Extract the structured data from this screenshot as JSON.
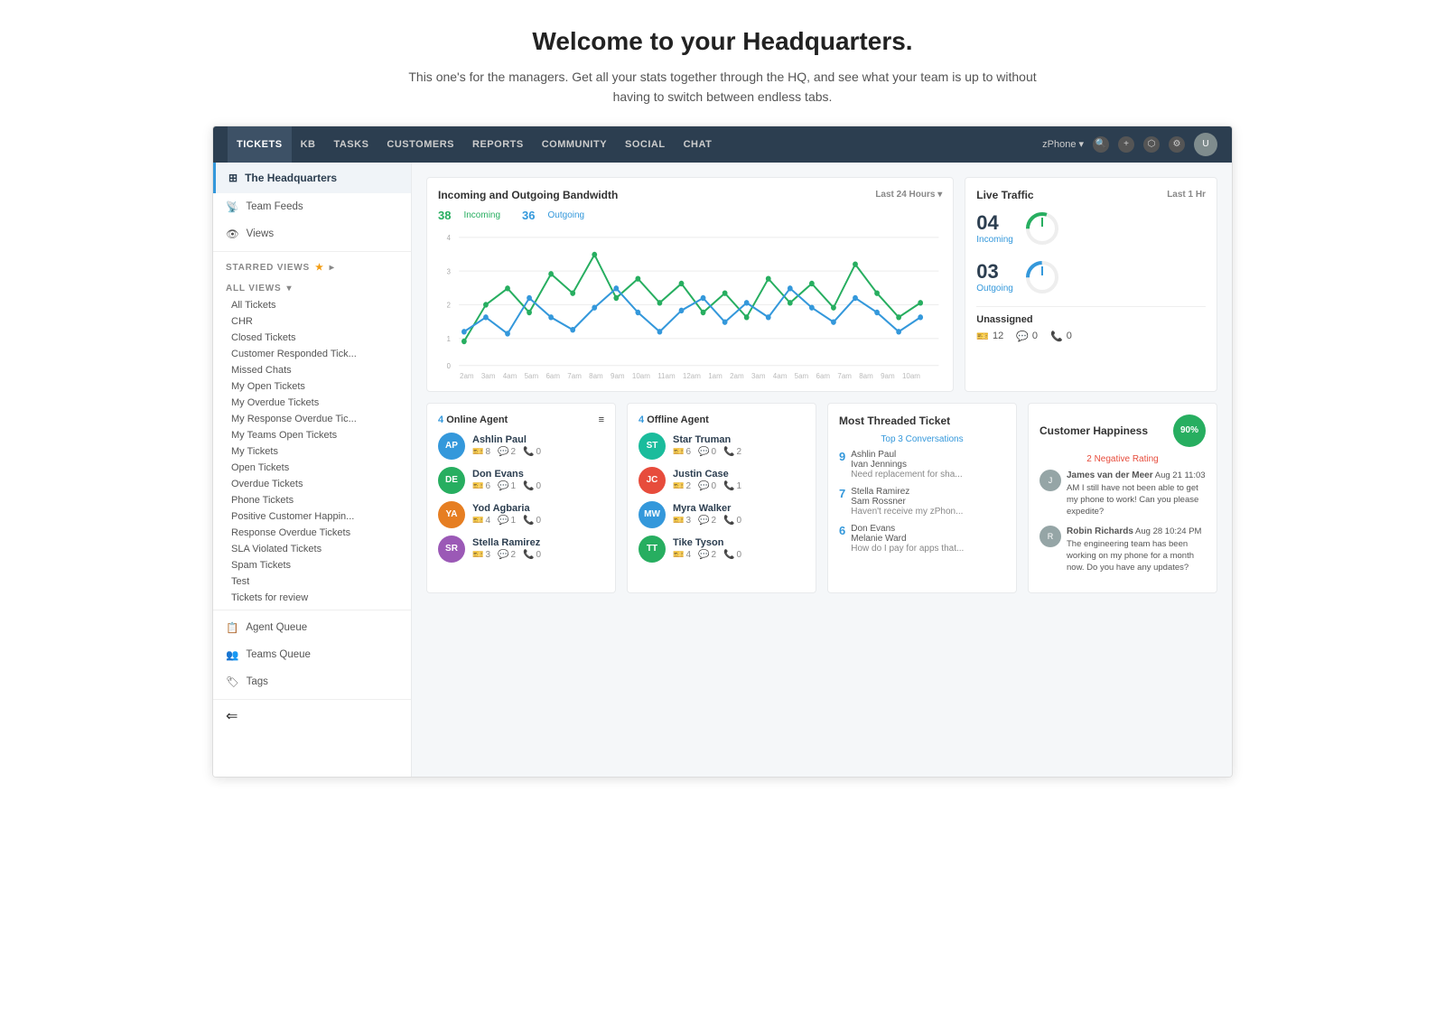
{
  "page": {
    "title": "Welcome to your Headquarters.",
    "subtitle": "This one's for the managers. Get all your stats together through the HQ, and see what your team is up to without having to switch between endless tabs."
  },
  "topnav": {
    "items": [
      "TICKETS",
      "KB",
      "TASKS",
      "CUSTOMERS",
      "REPORTS",
      "COMMUNITY",
      "SOCIAL",
      "CHAT"
    ],
    "active": "TICKETS",
    "brand": "zPhone",
    "icons": [
      "🔍",
      "+",
      "⬡",
      "⚙"
    ]
  },
  "sidebar": {
    "header": "The Headquarters",
    "items": [
      {
        "label": "Team Feeds",
        "icon": "📡"
      },
      {
        "label": "Views",
        "icon": "👁"
      }
    ],
    "starred_label": "STARRED VIEWS",
    "all_label": "ALL VIEWS",
    "links": [
      "All Tickets",
      "CHR",
      "Closed Tickets",
      "Customer Responded Tick...",
      "Missed Chats",
      "My Open Tickets",
      "My Overdue Tickets",
      "My Response Overdue Tic...",
      "My Teams Open Tickets",
      "My Tickets",
      "Open Tickets",
      "Overdue Tickets",
      "Phone Tickets",
      "Positive Customer Happin...",
      "Response Overdue Tickets",
      "SLA Violated Tickets",
      "Spam Tickets",
      "Test",
      "Tickets for review"
    ],
    "agent_queue": "Agent Queue",
    "teams_queue": "Teams Queue",
    "tags": "Tags",
    "collapse_icon": "⇐"
  },
  "bandwidth_chart": {
    "title": "Incoming and Outgoing Bandwidth",
    "time_range": "Last 24 Hours ▾",
    "incoming_count": "38",
    "incoming_label": "Incoming",
    "outgoing_count": "36",
    "outgoing_label": "Outgoing"
  },
  "live_traffic": {
    "title": "Live Traffic",
    "time_range": "Last 1 Hr",
    "incoming_number": "04",
    "incoming_label": "Incoming",
    "outgoing_number": "03",
    "outgoing_label": "Outgoing",
    "unassigned_title": "Unassigned",
    "unassigned_ticket": "12",
    "unassigned_chat": "0",
    "unassigned_phone": "0"
  },
  "online_agents": {
    "count": "4",
    "title": "Online Agent",
    "agents": [
      {
        "name": "Ashlin Paul",
        "initials": "AP",
        "tickets": "8",
        "chats": "2",
        "phone": "0",
        "color": "avatar-blue"
      },
      {
        "name": "Don Evans",
        "initials": "DE",
        "tickets": "6",
        "chats": "1",
        "phone": "0",
        "color": "avatar-green"
      },
      {
        "name": "Yod Agbaria",
        "initials": "YA",
        "tickets": "4",
        "chats": "1",
        "phone": "0",
        "color": "avatar-orange"
      },
      {
        "name": "Stella Ramirez",
        "initials": "SR",
        "tickets": "3",
        "chats": "2",
        "phone": "0",
        "color": "avatar-purple"
      }
    ]
  },
  "offline_agents": {
    "count": "4",
    "title": "Offline Agent",
    "agents": [
      {
        "name": "Star Truman",
        "initials": "ST",
        "tickets": "6",
        "chats": "0",
        "phone": "2",
        "color": "avatar-teal"
      },
      {
        "name": "Justin Case",
        "initials": "JC",
        "tickets": "2",
        "chats": "0",
        "phone": "1",
        "color": "avatar-red"
      },
      {
        "name": "Myra Walker",
        "initials": "MW",
        "tickets": "3",
        "chats": "2",
        "phone": "0",
        "color": "avatar-blue"
      },
      {
        "name": "Tike Tyson",
        "initials": "TT",
        "tickets": "4",
        "chats": "2",
        "phone": "0",
        "color": "avatar-green"
      }
    ]
  },
  "most_threaded": {
    "title": "Most Threaded Ticket",
    "subtitle": "Top 3 Conversations",
    "items": [
      {
        "number": "9",
        "name1": "Ashlin Paul",
        "name2": "Ivan Jennings",
        "desc": "Need replacement for sha..."
      },
      {
        "number": "7",
        "name1": "Stella Ramirez",
        "name2": "Sam Rossner",
        "desc": "Haven't receive my zPhon..."
      },
      {
        "number": "6",
        "name1": "Don Evans",
        "name2": "Melanie Ward",
        "desc": "How do I pay for apps that..."
      }
    ]
  },
  "customer_happiness": {
    "title": "Customer Happiness",
    "score": "90%",
    "negative_label": "2 Negative Rating",
    "reviews": [
      {
        "initial": "J",
        "name": "James van der Meer",
        "date": "Aug 21 11:03 AM",
        "text": "I still have not been able to get my phone to work! Can you please expedite?"
      },
      {
        "initial": "R",
        "name": "Robin Richards",
        "date": "Aug 28 10:24 PM",
        "text": "The engineering team has been working on my phone for a month now. Do you have any updates?"
      }
    ]
  }
}
